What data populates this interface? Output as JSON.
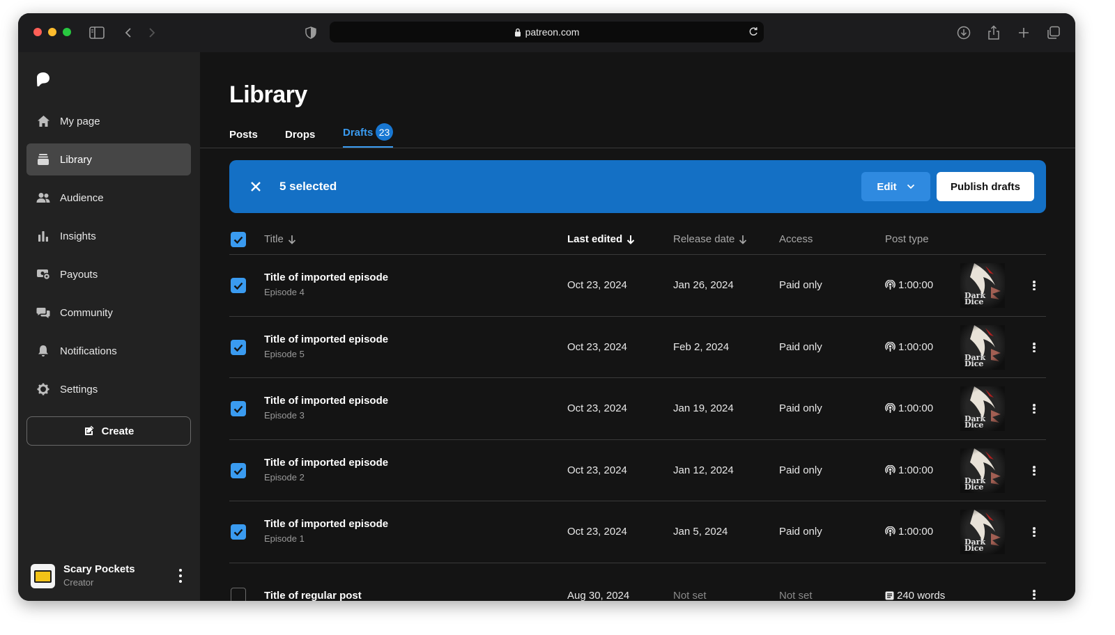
{
  "browser": {
    "url": "patreon.com"
  },
  "sidebar": {
    "items": [
      {
        "label": "My page",
        "icon": "home-icon"
      },
      {
        "label": "Library",
        "icon": "library-icon",
        "active": true
      },
      {
        "label": "Audience",
        "icon": "audience-icon"
      },
      {
        "label": "Insights",
        "icon": "insights-icon"
      },
      {
        "label": "Payouts",
        "icon": "payouts-icon"
      },
      {
        "label": "Community",
        "icon": "community-icon"
      },
      {
        "label": "Notifications",
        "icon": "bell-icon"
      },
      {
        "label": "Settings",
        "icon": "gear-icon"
      }
    ],
    "create_label": "Create",
    "profile": {
      "name": "Scary Pockets",
      "role": "Creator"
    }
  },
  "main": {
    "title": "Library",
    "tabs": [
      {
        "label": "Posts"
      },
      {
        "label": "Drops"
      },
      {
        "label": "Drafts",
        "badge": "23",
        "active": true
      }
    ],
    "selection": {
      "text": "5 selected",
      "edit_label": "Edit",
      "publish_label": "Publish drafts"
    },
    "table": {
      "headers": {
        "title": "Title",
        "last_edited": "Last edited",
        "release_date": "Release date",
        "access": "Access",
        "post_type": "Post type"
      },
      "rows": [
        {
          "checked": true,
          "title": "Title of imported episode",
          "subtitle": "Episode 4",
          "last_edited": "Oct 23, 2024",
          "release_date": "Jan 26, 2024",
          "access": "Paid only",
          "post_type": "1:00:00",
          "type_icon": "audio-icon",
          "thumb": "Dark Dice"
        },
        {
          "checked": true,
          "title": "Title of imported episode",
          "subtitle": "Episode 5",
          "last_edited": "Oct 23, 2024",
          "release_date": "Feb 2, 2024",
          "access": "Paid only",
          "post_type": "1:00:00",
          "type_icon": "audio-icon",
          "thumb": "Dark Dice"
        },
        {
          "checked": true,
          "title": "Title of imported episode",
          "subtitle": "Episode 3",
          "last_edited": "Oct 23, 2024",
          "release_date": "Jan 19, 2024",
          "access": "Paid only",
          "post_type": "1:00:00",
          "type_icon": "audio-icon",
          "thumb": "Dark Dice"
        },
        {
          "checked": true,
          "title": "Title of imported episode",
          "subtitle": "Episode 2",
          "last_edited": "Oct 23, 2024",
          "release_date": "Jan 12, 2024",
          "access": "Paid only",
          "post_type": "1:00:00",
          "type_icon": "audio-icon",
          "thumb": "Dark Dice"
        },
        {
          "checked": true,
          "title": "Title of imported episode",
          "subtitle": "Episode 1",
          "last_edited": "Oct 23, 2024",
          "release_date": "Jan 5, 2024",
          "access": "Paid only",
          "post_type": "1:00:00",
          "type_icon": "audio-icon",
          "thumb": "Dark Dice"
        },
        {
          "checked": false,
          "title": "Title of regular post",
          "subtitle": "",
          "last_edited": "Aug 30, 2024",
          "release_date": "Not set",
          "access": "Not set",
          "post_type": "240 words",
          "type_icon": "text-icon",
          "thumb": ""
        }
      ]
    }
  },
  "colors": {
    "accent": "#3a9bf0",
    "selection_bar": "#1470c5",
    "sidebar_bg": "#222222",
    "main_bg": "#141414"
  }
}
